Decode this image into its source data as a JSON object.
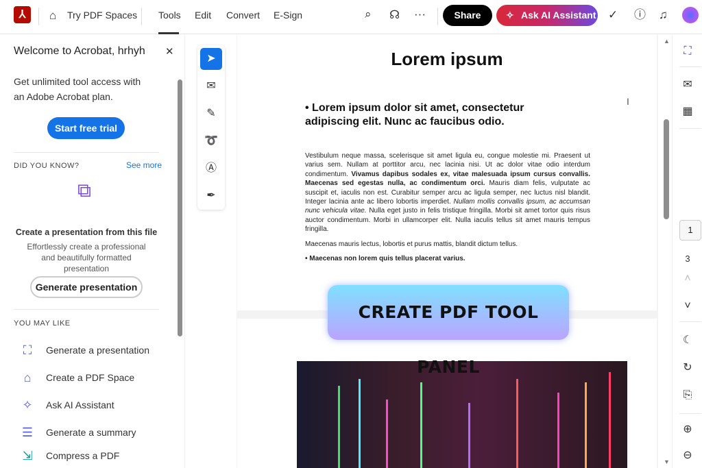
{
  "header": {
    "logo": "Adobe Acrobat",
    "spaces": "Try PDF Spaces",
    "nav": [
      "Tools",
      "Edit",
      "Convert",
      "E-Sign"
    ],
    "share": "Share",
    "ai": "Ask AI Assistant"
  },
  "left": {
    "title": "Welcome to Acrobat, hrhyh",
    "subtitle": "Get unlimited tool access with an Adobe Acrobat plan.",
    "trial": "Start free trial",
    "did_you_know": "DID YOU KNOW?",
    "see_more": "See more",
    "card_title": "Create a presentation from this file",
    "card_desc": "Effortlessly create a professional and beautifully formatted presentation",
    "card_button": "Generate presentation",
    "may_like": "YOU MAY LIKE",
    "items": [
      "Generate a presentation",
      "Create a PDF Space",
      "Ask AI Assistant",
      "Generate a summary",
      "Compress a PDF"
    ]
  },
  "doc": {
    "title": "Lorem ipsum",
    "bullet": "• Lorem ipsum dolor sit amet, consectetur adipiscing elit. Nunc ac faucibus odio.",
    "p1a": "Vestibulum neque massa, scelerisque sit amet ligula eu, congue molestie mi. Praesent ut varius sem. Nullam at porttitor arcu, nec lacinia nisi. Ut ac dolor vitae odio interdum condimentum. ",
    "p1b": "Vivamus dapibus sodales ex, vitae malesuada ipsum cursus convallis. Maecenas sed egestas nulla, ac condimentum orci.",
    "p1c": " Mauris diam felis, vulputate ac suscipit et, iaculis non est. Curabitur semper arcu ac ligula semper, nec luctus nisl blandit. Integer lacinia ante ac libero lobortis imperdiet. ",
    "p1d": "Nullam mollis convallis ipsum, ac accumsan nunc vehicula vitae.",
    "p1e": " Nulla eget justo in felis tristique fringilla. Morbi sit amet tortor quis risus auctor condimentum. Morbi in ullamcorper elit. Nulla iaculis tellus sit amet mauris tempus fringilla.",
    "p2": "Maecenas mauris lectus, lobortis et purus mattis, blandit dictum tellus.",
    "bullet2": "• Maecenas non lorem quis tellus placerat varius.",
    "banner": "CREATE PDF TOOL PANEL"
  },
  "right": {
    "current_page": "1",
    "total_pages": "3"
  }
}
